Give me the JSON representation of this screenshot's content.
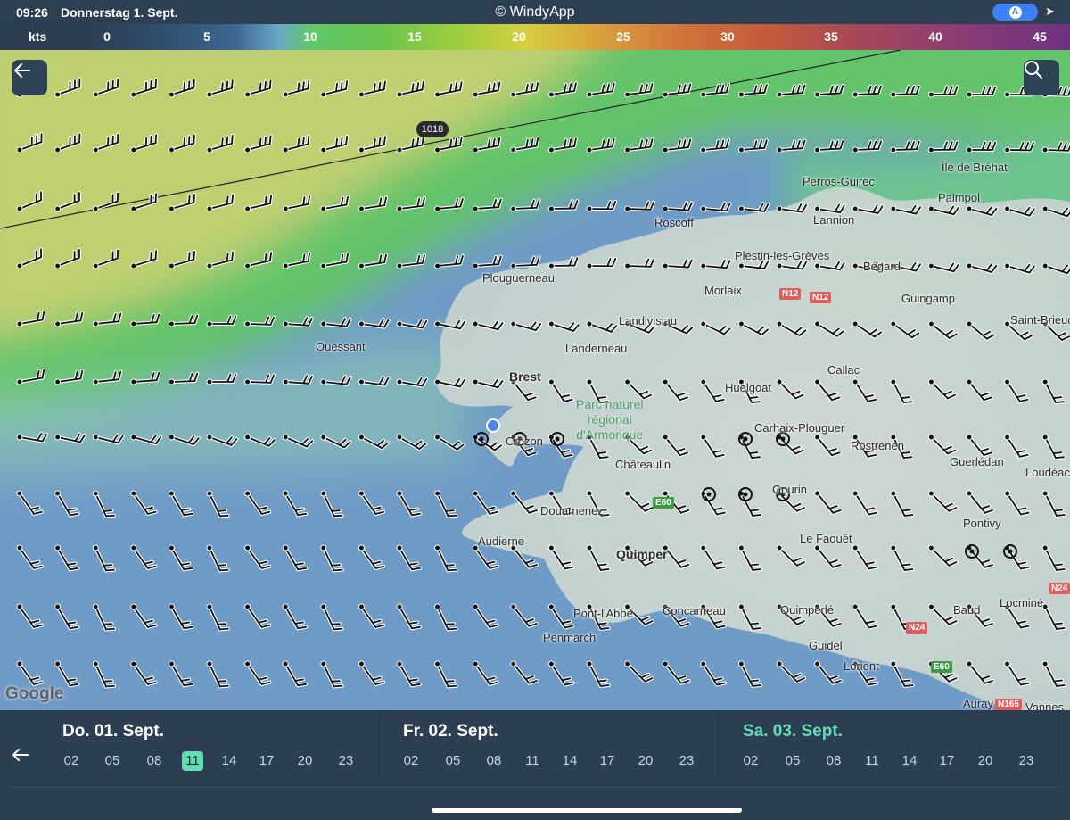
{
  "status_bar": {
    "time": "09:26",
    "date": "Donnerstag 1. Sept.",
    "app_title": "© WindyApp",
    "mode_badge": "A",
    "location_glyph": "➤"
  },
  "legend": {
    "unit": "kts",
    "ticks": [
      "0",
      "5",
      "10",
      "15",
      "20",
      "25",
      "30",
      "35",
      "40",
      "45"
    ]
  },
  "map": {
    "isobar_label": "1018",
    "attribution": "Google",
    "places": [
      {
        "name": "Île de Bréhat",
        "bold": false
      },
      {
        "name": "Perros-Guirec",
        "bold": false
      },
      {
        "name": "Paimpol",
        "bold": false
      },
      {
        "name": "Roscoff",
        "bold": false
      },
      {
        "name": "Lannion",
        "bold": false
      },
      {
        "name": "Plestin-les-Grèves",
        "bold": false
      },
      {
        "name": "Bégard",
        "bold": false
      },
      {
        "name": "Plouguerneau",
        "bold": false
      },
      {
        "name": "Morlaix",
        "bold": false
      },
      {
        "name": "Guingamp",
        "bold": false
      },
      {
        "name": "Landivisiau",
        "bold": false
      },
      {
        "name": "Saint-Brieuc",
        "bold": false
      },
      {
        "name": "Ouessant",
        "bold": false
      },
      {
        "name": "Landerneau",
        "bold": false
      },
      {
        "name": "Brest",
        "bold": true
      },
      {
        "name": "Callac",
        "bold": false
      },
      {
        "name": "Huelgoat",
        "bold": false
      },
      {
        "name": "Crozon",
        "bold": false
      },
      {
        "name": "Carhaix-Plouguer",
        "bold": false
      },
      {
        "name": "Rostrenen",
        "bold": false
      },
      {
        "name": "Châteaulin",
        "bold": false
      },
      {
        "name": "Guerlédan",
        "bold": false
      },
      {
        "name": "Loudéac",
        "bold": false
      },
      {
        "name": "Gourin",
        "bold": false
      },
      {
        "name": "Douarnenez",
        "bold": false
      },
      {
        "name": "Pontivy",
        "bold": false
      },
      {
        "name": "Audierne",
        "bold": false
      },
      {
        "name": "Quimper",
        "bold": true
      },
      {
        "name": "Le Faouët",
        "bold": false
      },
      {
        "name": "Pont-l'Abbé",
        "bold": false
      },
      {
        "name": "Concarneau",
        "bold": false
      },
      {
        "name": "Quimperlé",
        "bold": false
      },
      {
        "name": "Baud",
        "bold": false
      },
      {
        "name": "Locminé",
        "bold": false
      },
      {
        "name": "Penmarch",
        "bold": false
      },
      {
        "name": "Guidel",
        "bold": false
      },
      {
        "name": "Lorient",
        "bold": false
      },
      {
        "name": "Auray",
        "bold": false
      },
      {
        "name": "Vannes",
        "bold": false
      }
    ],
    "park_label": [
      "Parc naturel",
      "régional",
      "d'Armorique"
    ],
    "road_signs": [
      {
        "label": "N12",
        "color": "red"
      },
      {
        "label": "N12",
        "color": "red"
      },
      {
        "label": "E60",
        "color": "green"
      },
      {
        "label": "N24",
        "color": "red"
      },
      {
        "label": "N24",
        "color": "red"
      },
      {
        "label": "E60",
        "color": "green"
      },
      {
        "label": "N165",
        "color": "red"
      }
    ]
  },
  "timeline": {
    "days": [
      {
        "label": "Do. 01. Sept.",
        "active": false,
        "hours": [
          "02",
          "05",
          "08",
          "11",
          "14",
          "17",
          "20",
          "23"
        ],
        "selected_hour": "11"
      },
      {
        "label": "Fr. 02. Sept.",
        "active": false,
        "hours": [
          "02",
          "05",
          "08",
          "11",
          "14",
          "17",
          "20",
          "23"
        ],
        "selected_hour": ""
      },
      {
        "label": "Sa. 03. Sept.",
        "active": true,
        "hours": [
          "02",
          "05",
          "08",
          "11",
          "14",
          "17",
          "20",
          "23"
        ],
        "selected_hour": ""
      }
    ]
  },
  "colors": {
    "panel": "#2b3e52",
    "accent": "#61dcb3",
    "sea": "#7aa3c8",
    "land": "#cfd8d2"
  },
  "icons": {
    "back": "back-arrow-icon",
    "search": "search-icon",
    "timeline_back": "left-arrow-icon"
  }
}
